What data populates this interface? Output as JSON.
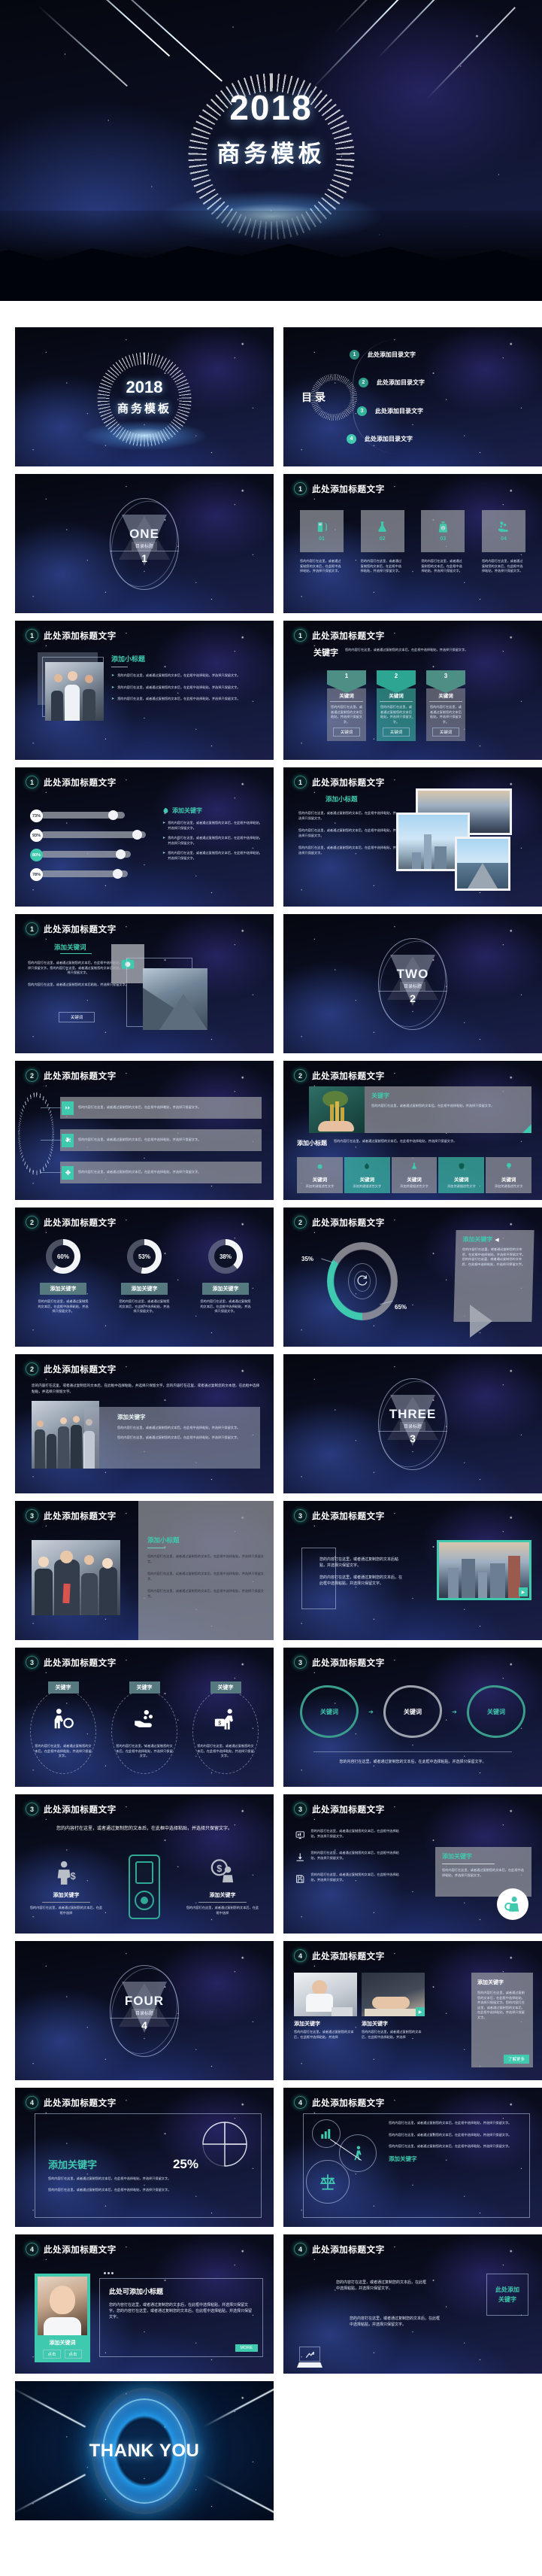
{
  "cover": {
    "year": "2018",
    "subtitle": "商务模板"
  },
  "common": {
    "slide_title": "此处添加标题文字",
    "body_text": "您的内容打在这里，或者通过复制您的文本后，在此框中选择粘贴，并选择只保留文字。",
    "body_text_short": "您的内容打在这里，或者通过复制您的文本后，在此框中选择粘贴，并选择只保留文字。",
    "sub_heading": "添加小标题",
    "keyword": "关键字",
    "keyword2": "关键词",
    "add_keyword": "添加关键字",
    "add_keyword2": "添加关键词",
    "section_label": "目录标题",
    "more": "MORE"
  },
  "toc": {
    "heading": "目录",
    "items": [
      {
        "num": "1",
        "label": "此处添加目录文字"
      },
      {
        "num": "2",
        "label": "此处添加目录文字"
      },
      {
        "num": "3",
        "label": "此处添加目录文字"
      },
      {
        "num": "4",
        "label": "此处添加目录文字"
      }
    ]
  },
  "dividers": [
    {
      "word": "ONE",
      "label": "目录标题",
      "num": "1"
    },
    {
      "word": "TWO",
      "label": "目录标题",
      "num": "2"
    },
    {
      "word": "THREE",
      "label": "目录标题",
      "num": "3"
    },
    {
      "word": "FOUR",
      "label": "目录标题",
      "num": "4"
    }
  ],
  "slides": {
    "four_cards": {
      "section": "1",
      "title": "此处添加标题文字",
      "cards": [
        {
          "num": "01",
          "icon": "fuel-pump-icon",
          "text": "您的内容打在这里，或者通过复制您的文本后，在此框中选择粘贴，并选择只保留文字。"
        },
        {
          "num": "02",
          "icon": "flask-icon",
          "text": "您的内容打在这里，或者通过复制您的文本后，在此框中选择粘贴，并选择只保留文字。"
        },
        {
          "num": "03",
          "icon": "money-bag-icon",
          "text": "您的内容打在这里，或者通过复制您的文本后，在此框中选择粘贴，并选择只保留文字。"
        },
        {
          "num": "04",
          "icon": "coins-hand-icon",
          "text": "您的内容打在这里，或者通过复制您的文本后，在此框中选择粘贴，并选择只保留文字。"
        }
      ]
    },
    "photo_bullets": {
      "section": "1",
      "title": "此处添加标题文字",
      "sub_heading": "添加小标题",
      "bullets": [
        "您的内容打在这里，或者通过复制您的文本后，在此框中选择粘贴，并选择只保留文字。",
        "您的内容打在这里，或者通过复制您的文本后，在此框中选择粘贴，并选择只保留文字。",
        "您的内容打在这里，或者通过复制您的文本后，在此框中选择粘贴，并选择只保留文字。"
      ]
    },
    "hex_three": {
      "section": "1",
      "title": "此处添加标题文字",
      "lead_label": "关键字",
      "lead_text": "您的内容打在这里，或者通过复制您的文本后，在此框中选择粘贴，并选择只保留文字。",
      "columns": [
        {
          "num": "1",
          "head": "关键词",
          "text": "您的内容打在这里，或者通过复制您的文本后粘贴，并选择只保留文字。",
          "chip": "关键词"
        },
        {
          "num": "2",
          "head": "关键词",
          "text": "您的内容打在这里，或者通过复制您的文本后粘贴，并选择只保留文字。",
          "chip": "关键词"
        },
        {
          "num": "3",
          "head": "关键词",
          "text": "您的内容打在这里，或者通过复制您的文本后粘贴，并选择只保留文字。",
          "chip": "关键词"
        }
      ]
    },
    "bars": {
      "section": "1",
      "title": "此处添加标题文字",
      "right_head": "添加关键字",
      "rows": [
        {
          "pct": "73%",
          "value": 73,
          "highlight": false
        },
        {
          "pct": "93%",
          "value": 93,
          "highlight": false
        },
        {
          "pct": "80%",
          "value": 80,
          "highlight": true
        },
        {
          "pct": "78%",
          "value": 78,
          "highlight": false
        }
      ],
      "bullets": [
        "您的内容打在这里，或者通过复制您的文本后，在此框中选择粘贴，并选择只保留文字。",
        "您的内容打在这里，或者通过复制您的文本后，在此框中选择粘贴，并选择只保留文字。",
        "您的内容打在这里，或者通过复制您的文本后，在此框中选择粘贴，并选择只保留文字。"
      ]
    },
    "photo_collage": {
      "section": "1",
      "title": "此处添加标题文字",
      "sub_heading": "添加小标题",
      "paras": [
        "您的内容打在这里，或者通过复制您的文本后，在此框中选择粘贴，并选择只保留文字。",
        "您的内容打在这里，或者通过复制您的文本后，在此框中选择粘贴，并选择只保留文字。",
        "您的内容打在这里，或者通过复制您的文本后，在此框中选择粘贴，并选择只保留文字。"
      ]
    },
    "camera": {
      "section": "1",
      "title": "此处添加标题文字",
      "sub_heading": "添加关键词",
      "paras": [
        "您的内容打在这里，或者通过复制您的文本后，在此框中选择粘贴，并选择只保留文字。您的内容打在这里，或者通过复制您的文本后粘贴，并选择只保留文字。",
        "您的内容打在这里，或者通过复制您的文本后粘贴，并选择只保留文字。"
      ],
      "button": "关键词",
      "icon": "camera-icon"
    },
    "callouts": {
      "section": "2",
      "title": "此处添加标题文字",
      "items": [
        {
          "icon": "arrows-icon",
          "text": "您的内容打在这里，或者通过复制您的文本后，在此框中选择粘贴，并选择只保留文字。"
        },
        {
          "icon": "puzzle-icon",
          "text": "您的内容打在这里，或者通过复制您的文本后，在此框中选择粘贴，并选择只保留文字。"
        },
        {
          "icon": "diamond-icon",
          "text": "您的内容打在这里，或者通过复制您的文本后，在此框中选择粘贴，并选择只保留文字。"
        }
      ]
    },
    "money_tree": {
      "section": "2",
      "title": "此处添加标题文字",
      "panel_head": "关键字",
      "panel_text": "您的内容打在这里，或者通过复制您的文本后，在此框中选择粘贴，并选择只保留文字。",
      "sub_heading": "添加小标题",
      "sub_text": "您的内容打在这里，或者通过复制您的文本后，在此框中选择粘贴，并选择只保留文字。",
      "cards": [
        {
          "icon": "gear-icon",
          "head": "关键词",
          "text": "添加关键描述性文字",
          "active": false
        },
        {
          "icon": "drop-icon",
          "head": "关键词",
          "text": "添加关键描述性文字",
          "active": true
        },
        {
          "icon": "flask-icon",
          "head": "关键词",
          "text": "添加关键描述性文字",
          "active": false
        },
        {
          "icon": "shield-icon",
          "head": "关键词",
          "text": "添加关键描述性文字",
          "active": true
        },
        {
          "icon": "bulb-icon",
          "head": "关键词",
          "text": "添加关键描述性文字",
          "active": false
        }
      ]
    },
    "donuts": {
      "section": "2",
      "title": "此处添加标题文字",
      "items": [
        {
          "pct": "60%",
          "value": 60,
          "head": "添加关键字",
          "text": "您的内容打在这里，或者通过复制您的文本后，在此框中选择粘贴，并选择只保留文字。"
        },
        {
          "pct": "53%",
          "value": 53,
          "head": "添加关键字",
          "text": "您的内容打在这里，或者通过复制您的文本后，在此框中选择粘贴，并选择只保留文字。"
        },
        {
          "pct": "38%",
          "value": 38,
          "head": "添加关键字",
          "text": "您的内容打在这里，或者通过复制您的文本后，在此框中选择粘贴，并选择只保留文字。"
        }
      ]
    },
    "big_donut": {
      "section": "2",
      "title": "此处添加标题文字",
      "left_pct": "35%",
      "left_value": 35,
      "right_pct": "65%",
      "right_value": 65,
      "panel_head": "添加关键字",
      "panel_text": "您的内容打在这里，或者通过复制您的文本后，在此框中选择粘贴，并选择只保留文字。您的内容打在这里，或者通过复制您的文本后，在此框中选择粘贴，并选择只保留文字。"
    },
    "team_overlay": {
      "section": "2",
      "title": "此处添加标题文字",
      "lead": "您的内容打在这里，或者通过复制您的文本后，在此框中选择粘贴，并选择只保留文字。您的内容打在这里，或者通过复制您的文本后，在此框中选择粘贴，并选择只保留文字。",
      "panel_head": "添加关键字",
      "paras": [
        "您的内容打在这里，或者通过复制您的文本后，在此框中选择粘贴，并选择只保留文字。",
        "您的内容打在这里，或者通过复制您的文本后，在此框中选择粘贴，并选择只保留文字。"
      ]
    },
    "photo_gray": {
      "section": "3",
      "title": "此处添加标题文字",
      "sub_heading": "添加小标题",
      "paras": [
        "您的内容打在这里，或者通过复制您的文本后，在此框中选择粘贴，并选择只保留文字。",
        "您的内容打在这里，或者通过复制您的文本后，在此框中选择粘贴，并选择只保留文字。",
        "您的内容打在这里，或者通过复制您的文本后，在此框中选择粘贴，并选择只保留文字。"
      ]
    },
    "city": {
      "section": "3",
      "title": "此处添加标题文字",
      "paras": [
        "您的内容打在这里，或者通过复制您的文本后粘贴，并选择只保留文字。",
        "您的内容打在这里，或者通过复制您的文本后，在此框中选择粘贴，并选择只保留文字。"
      ]
    },
    "three_circles": {
      "section": "3",
      "title": "此处添加标题文字",
      "items": [
        {
          "head": "关键字",
          "icon": "person-gear-icon",
          "text": "您的内容打在这里，或者通过复制您的文本后，在此框中选择粘贴，并选择只保留文字。"
        },
        {
          "head": "关键字",
          "icon": "hand-coins-icon",
          "text": "您的内容打在这里，或者通过复制您的文本后，在此框中选择粘贴，并选择只保留文字。"
        },
        {
          "head": "关键字",
          "icon": "person-cart-icon",
          "text": "您的内容打在这里，或者通过复制您的文本后，在此框中选择粘贴，并选择只保留文字。"
        }
      ]
    },
    "blobs": {
      "section": "3",
      "title": "此处添加标题文字",
      "items": [
        {
          "label": "关键词",
          "color": "teal"
        },
        {
          "label": "关键词",
          "color": "gray"
        },
        {
          "label": "关键词",
          "color": "teal"
        }
      ],
      "footer": "您的内容打在这里，或者通过复制您的文本后，在此框中选择粘贴，并选择只保留文字。"
    },
    "icons_player": {
      "section": "3",
      "title": "此处添加标题文字",
      "lead": "您的内容打在这里，或者通过复制您的文本后，在此框中选择粘贴，并选择只保留文字。",
      "left": {
        "icon": "person-money-icon",
        "head": "添加关键字",
        "text": "您的内容打在这里，或者通过复制您的文本后，在此框中选择"
      },
      "right": {
        "icon": "person-dollar-icon",
        "head": "添加关键字",
        "text": "您的内容打在这里，或者通过复制您的文本后，在此框中选择"
      },
      "center_icon": "music-player-icon"
    },
    "icon_list": {
      "section": "3",
      "title": "此处添加标题文字",
      "items": [
        {
          "icon": "monitor-icon",
          "text": "您的内容打在这里，或者通过复制您的文本后，在此框中选择粘贴，并选择只保留文字。"
        },
        {
          "icon": "download-icon",
          "text": "您的内容打在这里，或者通过复制您的文本后，在此框中选择粘贴，并选择只保留文字。"
        },
        {
          "icon": "save-icon",
          "text": "您的内容打在这里，或者通过复制您的文本后，在此框中选择粘贴，并选择只保留文字。"
        }
      ],
      "panel_head": "添加关键字",
      "panel_text": "您的内容打在这里，或者通过复制您的文本后，在此框中选择粘贴，并选择只保留文字。",
      "avatar_icon": "user-search-icon"
    },
    "two_photos": {
      "section": "4",
      "title": "此处添加标题文字",
      "cards": [
        {
          "head": "添加关键字",
          "text": "您的内容打在这里，或者通过复制您的文本后，在此框中选择粘贴，并选择"
        },
        {
          "head": "添加关键字",
          "text": "您的内容打在这里，或者通过复制您的文本后，在此框中选择粘贴，并选择"
        }
      ],
      "panel_head": "添加关键字",
      "panel_text": "您的内容打在这里，或者通过复制您的文本后，在此框中选择粘贴，并选择只保留文字。您的内容打在这里，或者通过复制您的文本后，在此框中选择粘贴，并选择只保留文字。",
      "panel_button": "了解更多"
    },
    "pie25": {
      "section": "4",
      "title": "此处添加标题文字",
      "head": "添加关键字",
      "pct": "25%",
      "value": 25,
      "paras": [
        "您的内容打在这里，或者通过复制您的文本后，在此框中选择粘贴，并选择只保留文字。",
        "您的内容打在这里，或者通过复制您的文本后，在此框中选择粘贴，并选择只保留文字。"
      ]
    },
    "circle_icons": {
      "section": "4",
      "title": "此处添加标题文字",
      "icons": [
        "chart-icon",
        "person-walk-icon",
        "scales-icon"
      ],
      "paras": [
        "您的内容打在这里，或者通过复制您的文本后，在此框中选择粘贴，并选择只保留文字。",
        "您的内容打在这里，或者通过复制您的文本后，在此框中选择粘贴，并选择只保留文字。",
        "您的内容打在这里，或者通过复制您的文本后，在此框中选择粘贴，并选择只保留文字。"
      ],
      "footer_head": "添加关键字"
    },
    "portrait_card": {
      "section": "4",
      "title": "此处添加标题文字",
      "card_head": "添加关键词",
      "tags": [
        "点击",
        "点击"
      ],
      "panel_head": "此处可添加小标题",
      "panel_text": "您的内容打在这里，或者通过复制您的文本后，在此框中选择粘贴，并选择只保留文字。您的内容打在这里，或者通过复制您的文本后，在此框中选择粘贴，并选择只保留文字。",
      "more": "MORE"
    },
    "closing_text": {
      "section": "4",
      "title": "此处添加标题文字",
      "paras": [
        "您的内容打在这里，或者通过复制您的文本后，在此框中选择粘贴，并选择只保留文字。",
        "您的内容打在这里，或者通过复制您的文本后，在此框中选择粘贴，并选择只保留文字。"
      ],
      "badge_line1": "此处添加",
      "badge_line2": "关键字",
      "icon": "laptop-chart-icon"
    }
  },
  "thanks": {
    "text": "THANK YOU"
  },
  "colors": {
    "accent_teal": "#3fc9ae",
    "panel_gray": "#97999f",
    "bg_dark": "#05070f",
    "text_light": "#ffffff"
  }
}
